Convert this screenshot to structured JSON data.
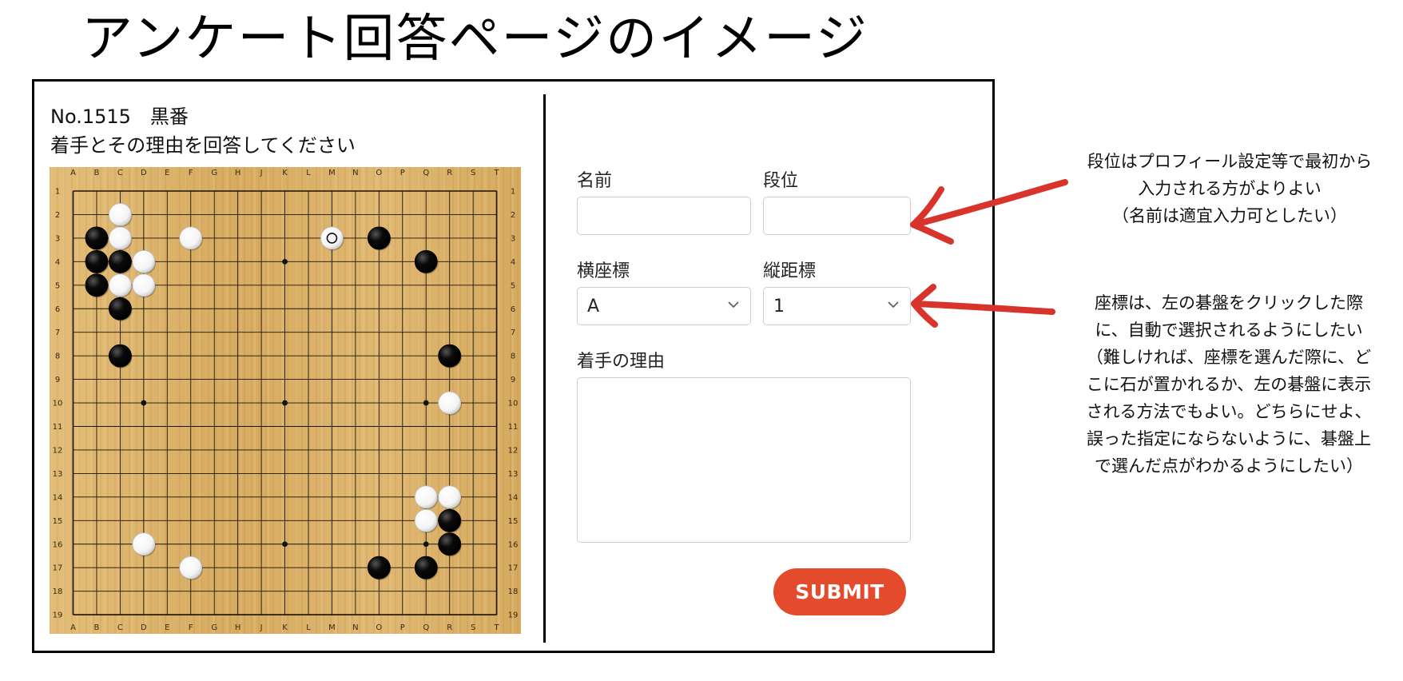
{
  "page_title": "アンケート回答ページのイメージ",
  "problem": {
    "number": "No.1515",
    "to_play": "黒番",
    "prompt": "着手とその理由を回答してください"
  },
  "board": {
    "columns": [
      "A",
      "B",
      "C",
      "D",
      "E",
      "F",
      "G",
      "H",
      "J",
      "K",
      "L",
      "M",
      "N",
      "O",
      "P",
      "Q",
      "R",
      "S",
      "T"
    ],
    "rows": [
      "1",
      "2",
      "3",
      "4",
      "5",
      "6",
      "7",
      "8",
      "9",
      "10",
      "11",
      "12",
      "13",
      "14",
      "15",
      "16",
      "17",
      "18",
      "19"
    ],
    "colors": {
      "black": "#0a0a0a",
      "white": "#f4f4f4"
    },
    "star_points": [
      [
        4,
        4
      ],
      [
        10,
        4
      ],
      [
        16,
        4
      ],
      [
        4,
        10
      ],
      [
        10,
        10
      ],
      [
        16,
        10
      ],
      [
        4,
        16
      ],
      [
        10,
        16
      ],
      [
        16,
        16
      ]
    ],
    "stones": [
      {
        "color": "white",
        "col": 3,
        "row": 2
      },
      {
        "color": "black",
        "col": 2,
        "row": 3
      },
      {
        "color": "white",
        "col": 3,
        "row": 3
      },
      {
        "color": "white",
        "col": 6,
        "row": 3
      },
      {
        "color": "white",
        "col": 12,
        "row": 3,
        "last_move": true
      },
      {
        "color": "black",
        "col": 14,
        "row": 3
      },
      {
        "color": "black",
        "col": 2,
        "row": 4
      },
      {
        "color": "black",
        "col": 3,
        "row": 4
      },
      {
        "color": "white",
        "col": 4,
        "row": 4
      },
      {
        "color": "black",
        "col": 16,
        "row": 4
      },
      {
        "color": "black",
        "col": 2,
        "row": 5
      },
      {
        "color": "white",
        "col": 3,
        "row": 5
      },
      {
        "color": "white",
        "col": 4,
        "row": 5
      },
      {
        "color": "black",
        "col": 3,
        "row": 6
      },
      {
        "color": "black",
        "col": 3,
        "row": 8
      },
      {
        "color": "black",
        "col": 17,
        "row": 8
      },
      {
        "color": "white",
        "col": 17,
        "row": 10
      },
      {
        "color": "white",
        "col": 16,
        "row": 14
      },
      {
        "color": "white",
        "col": 17,
        "row": 14
      },
      {
        "color": "white",
        "col": 16,
        "row": 15
      },
      {
        "color": "black",
        "col": 17,
        "row": 15
      },
      {
        "color": "white",
        "col": 4,
        "row": 16
      },
      {
        "color": "black",
        "col": 17,
        "row": 16
      },
      {
        "color": "white",
        "col": 6,
        "row": 17
      },
      {
        "color": "black",
        "col": 14,
        "row": 17
      },
      {
        "color": "black",
        "col": 16,
        "row": 17
      }
    ]
  },
  "form": {
    "name_label": "名前",
    "name_value": "",
    "rank_label": "段位",
    "rank_value": "",
    "x_label": "横座標",
    "x_value": "A",
    "y_label": "縦距標",
    "y_value": "1",
    "reason_label": "着手の理由",
    "reason_value": "",
    "submit_label": "SUBMIT",
    "submit_color": "#e34b2c"
  },
  "annotations": {
    "rank_note": [
      "段位はプロフィール設定等で最初から",
      "入力される方がよりよい",
      "（名前は適宜入力可としたい）"
    ],
    "coords_note": [
      "座標は、左の碁盤をクリックした際",
      "に、自動で選択されるようにしたい",
      "（難しければ、座標を選んだ際に、ど",
      "こに石が置かれるか、左の碁盤に表示",
      "される方法でもよい。どちらにせよ、",
      "誤った指定にならないように、碁盤上",
      "で選んだ点がわかるようにしたい）"
    ],
    "arrow_color": "#d8342b"
  }
}
